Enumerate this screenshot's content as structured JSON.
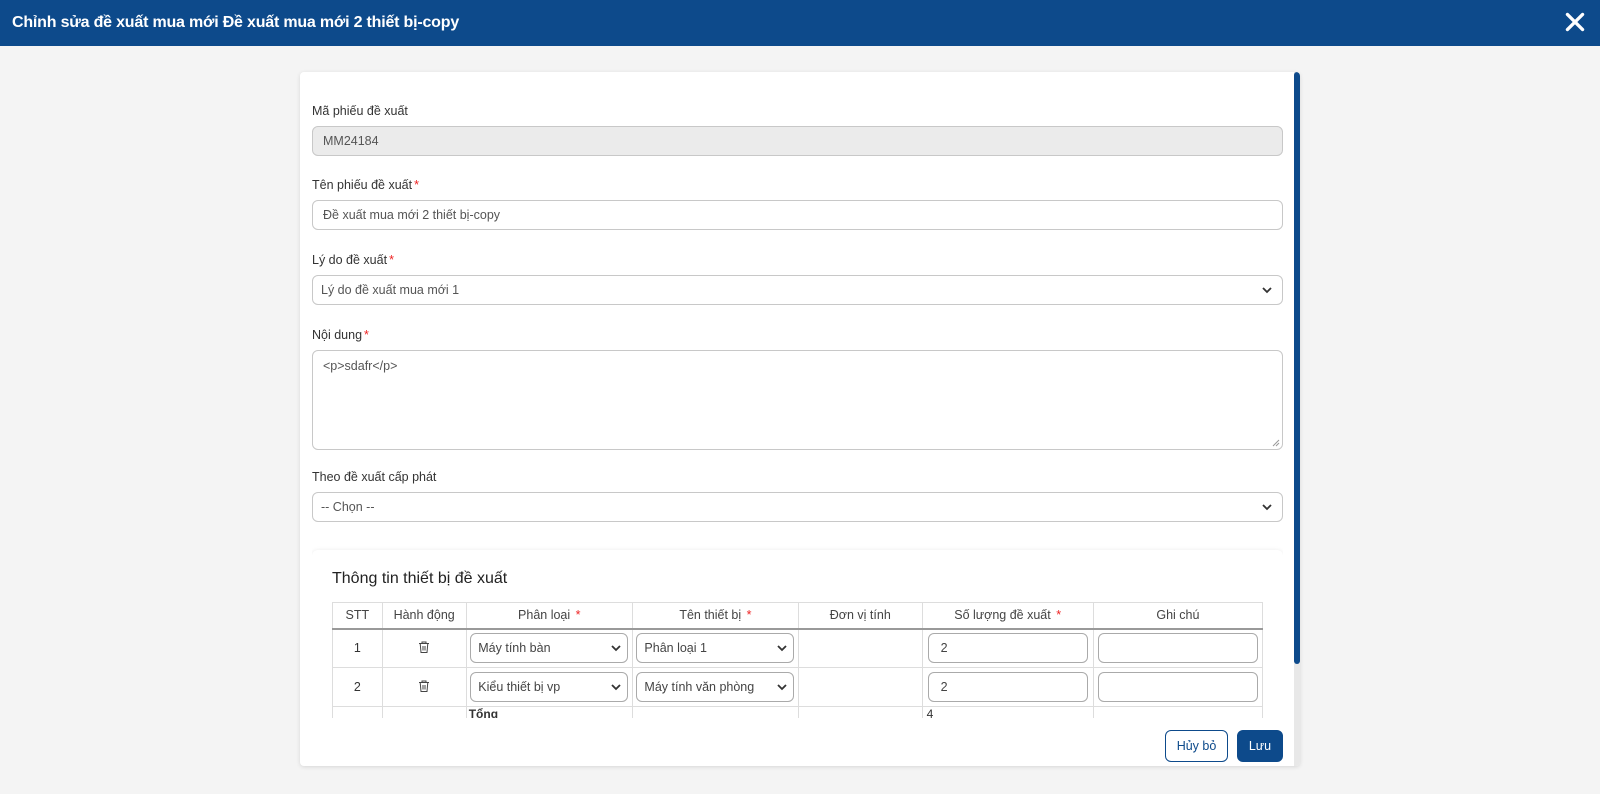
{
  "header": {
    "title": "Chỉnh sửa đề xuất mua mới Đề xuất mua mới 2 thiết bị-copy",
    "close_icon": "close-icon"
  },
  "form": {
    "code_label": "Mã phiếu đề xuất",
    "code_value": "MM24184",
    "name_label": "Tên phiếu đề xuất",
    "name_value": "Đề xuất mua mới 2 thiết bị-copy",
    "reason_label": "Lý do đề xuất",
    "reason_value": "Lý do đề xuất mua mới 1",
    "content_label": "Nội dung",
    "content_value": "<p>sdafr</p>",
    "allocation_label": "Theo đề xuất cấp phát",
    "allocation_value": "-- Chọn --",
    "required_mark": "*"
  },
  "devices": {
    "title": "Thông tin thiết bị đề xuất",
    "columns": [
      "STT",
      "Hành động",
      "Phân loại",
      "Tên thiết bị",
      "Đơn vị tính",
      "Số lượng đề xuất",
      "Ghi chú"
    ],
    "rows": [
      {
        "stt": "1",
        "category": "Máy tính bàn",
        "device": "Phân loại 1",
        "unit": "",
        "qty": "2",
        "note": ""
      },
      {
        "stt": "2",
        "category": "Kiểu thiết bị vp",
        "device": "Máy tính văn phòng",
        "unit": "",
        "qty": "2",
        "note": ""
      }
    ],
    "total_label": "Tổng",
    "total_qty": "4"
  },
  "actions": {
    "cancel_label": "Hủy bỏ",
    "save_label": "Lưu"
  },
  "colors": {
    "primary": "#0d4a8b",
    "required": "#e22222"
  }
}
